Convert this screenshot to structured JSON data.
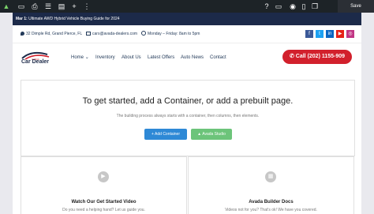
{
  "editor": {
    "save_label": "Save",
    "icons": [
      "avada-logo-icon",
      "layout-icon",
      "print-icon",
      "sections-icon",
      "library-icon",
      "add-icon",
      "more-icon",
      "help-icon",
      "desktop-icon",
      "preview-icon",
      "page-icon",
      "copy-icon"
    ]
  },
  "site": {
    "notice": {
      "strong": "Mar 1:",
      "text": " Ultimate AWD Hybrid Vehicle Buying Guide for 2024"
    },
    "contact": {
      "address": "32 Dimple Rd, Grand Pierce, FL",
      "email": "cars@avada-dealers.com",
      "hours": "Monday – Friday: 8am to 5pm"
    },
    "social_icons": [
      "facebook-icon",
      "twitter-icon",
      "linkedin-icon",
      "youtube-icon",
      "instagram-icon"
    ],
    "logo": {
      "small": "AVADA",
      "text": "Car Dealer"
    },
    "nav": {
      "home": "Home",
      "inventory": "Inventory",
      "about": "About Us",
      "offers": "Latest Offers",
      "news": "Auto News",
      "contact": "Contact"
    },
    "call": "Call (202) 1155-909",
    "hero": {
      "title": "To get started, add a Container, or add a prebuilt page.",
      "subtitle": "The building process always starts with a container, then columns, then elements.",
      "add_container": "Add Container",
      "avada_studio": "Avada Studio"
    },
    "cards": [
      {
        "title": "Watch Our Get Started Video",
        "text": "Do you need a helping hand? Let us guide you."
      },
      {
        "title": "Avada Builder Docs",
        "text": "Videos not for you? That's ok! We have you covered."
      }
    ]
  },
  "colors": {
    "navy": "#1c2a49",
    "red": "#d2202c",
    "blue": "#2e89d6",
    "green": "#6cc47a"
  }
}
